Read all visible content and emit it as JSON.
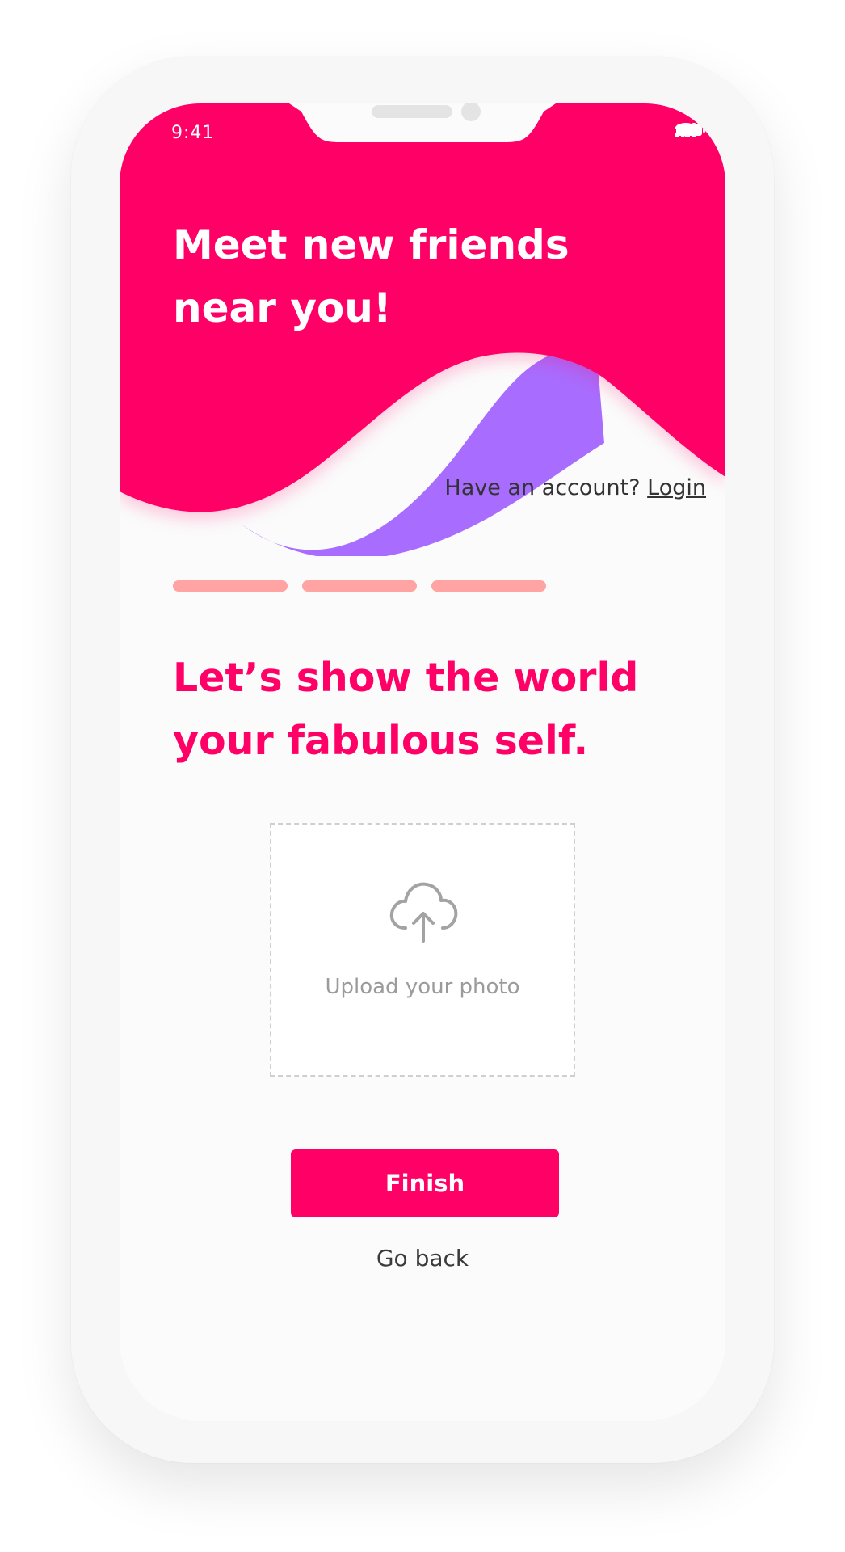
{
  "status_bar": {
    "time": "9:41",
    "icons": [
      "signal-icon",
      "wifi-icon",
      "battery-icon"
    ]
  },
  "hero": {
    "title": "Meet new friends near you!",
    "account_prompt": "Have an account?",
    "login_label": "Login"
  },
  "progress": {
    "steps_total": 3,
    "steps_completed": 3
  },
  "main": {
    "headline": "Let’s show the world your fabulous self.",
    "upload_label": "Upload your photo",
    "upload_icon": "cloud-upload-icon",
    "finish_label": "Finish",
    "go_back_label": "Go back"
  },
  "colors": {
    "brand_pink": "#ff0066",
    "accent_purple": "#a86cff",
    "progress_salmon": "#ffa3a3",
    "muted_gray": "#9b9b9b"
  }
}
